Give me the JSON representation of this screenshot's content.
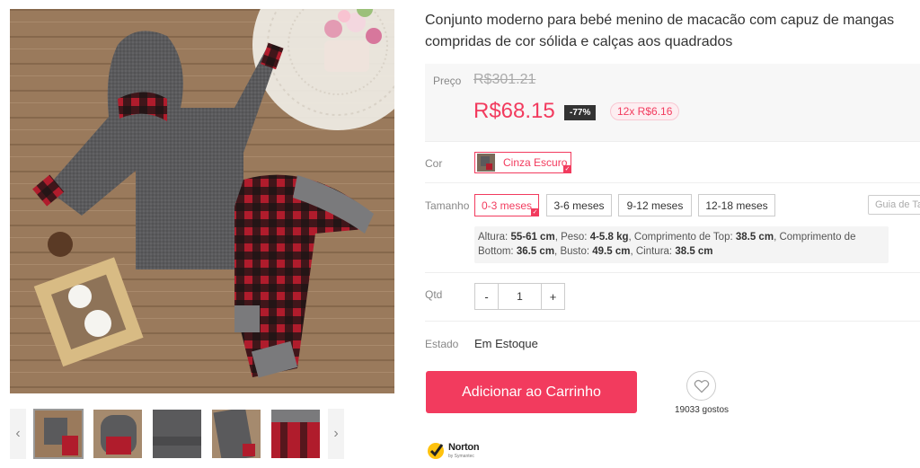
{
  "product": {
    "title": "Conjunto moderno para bebé menino de macacão com capuz de mangas compridas de cor sólida e calças aos quadrados"
  },
  "price": {
    "label": "Preço",
    "original": "R$301.21",
    "current": "R$68.15",
    "discount": "-77%",
    "installments": "12x R$6.16"
  },
  "color": {
    "label": "Cor",
    "selected": "Cinza Escuro"
  },
  "size": {
    "label": "Tamanho",
    "options": [
      "0-3 meses",
      "3-6 meses",
      "9-12 meses",
      "12-18 meses"
    ],
    "selected_index": 0,
    "guide_label": "Guia de Tamanhos",
    "details": {
      "height_label": "Altura:",
      "height": "55-61 cm",
      "weight_label": "Peso:",
      "weight": "4-5.8 kg",
      "top_length_label": "Comprimento de Top:",
      "top_length": "38.5 cm",
      "bottom_length_label": "Comprimento de Bottom:",
      "bottom_length": "36.5 cm",
      "bust_label": "Busto:",
      "bust": "49.5 cm",
      "waist_label": "Cintura:",
      "waist": "38.5 cm"
    }
  },
  "quantity": {
    "label": "Qtd",
    "minus": "-",
    "value": "1",
    "plus": "+"
  },
  "stock": {
    "label": "Estado",
    "value": "Em Estoque"
  },
  "actions": {
    "add_to_cart": "Adicionar ao Carrinho",
    "likes": "19033 gostos"
  },
  "gallery": {
    "prev_icon": "chevron-left-icon",
    "next_icon": "chevron-right-icon",
    "thumbnail_count": 5
  },
  "badge": {
    "brand": "Norton",
    "sub": "by Symantec"
  },
  "colors": {
    "accent": "#f23b5e",
    "price_bg": "#f7f7f7",
    "discount_bg": "#333333"
  }
}
